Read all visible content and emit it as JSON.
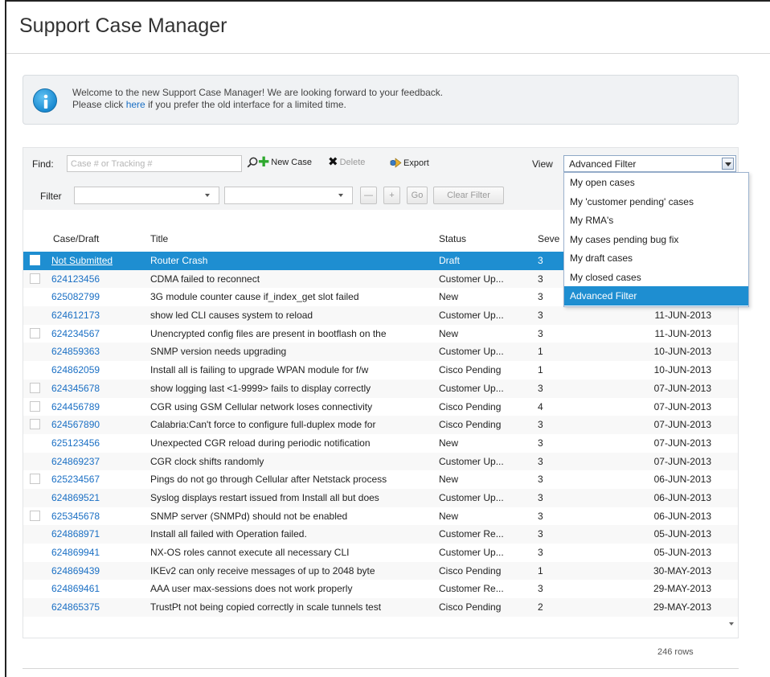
{
  "page": {
    "title": "Support Case Manager"
  },
  "banner": {
    "line1": "Welcome to the new Support Case Manager! We are looking forward to your feedback.",
    "line2_pre": "Please click ",
    "line2_link": "here",
    "line2_post": " if you prefer the old interface for a limited time."
  },
  "toolbar": {
    "find_label": "Find:",
    "find_placeholder": "Case # or Tracking #",
    "new_case": "New Case",
    "delete": "Delete",
    "export": "Export",
    "view_label": "View",
    "view_value": "Advanced Filter",
    "filter_label": "Filter",
    "go": "Go",
    "clear_filter": "Clear Filter",
    "minus_symbol": "—",
    "plus_symbol": "+"
  },
  "view_options": [
    "My open cases",
    "My 'customer pending' cases",
    "My RMA's",
    "My cases pending bug fix",
    "My draft cases",
    "My closed cases",
    "Advanced Filter"
  ],
  "columns": {
    "case": "Case/Draft",
    "title": "Title",
    "status": "Status",
    "severity": "Seve"
  },
  "rows": [
    {
      "case": "Not Submitted",
      "title": "Router Crash",
      "status": "Draft",
      "sev": "3",
      "date": "",
      "checkbox": true,
      "selected": true
    },
    {
      "case": "624123456",
      "title": "CDMA failed to reconnect",
      "status": "Customer Up...",
      "sev": "3",
      "date": "",
      "checkbox": true
    },
    {
      "case": "625082799",
      "title": "3G module counter cause if_index_get  slot failed",
      "status": "New",
      "sev": "3",
      "date": "",
      "checkbox": false
    },
    {
      "case": "624612173",
      "title": "show led CLI causes system to reload",
      "status": "Customer Up...",
      "sev": "3",
      "date": "11-JUN-2013",
      "checkbox": false
    },
    {
      "case": "624234567",
      "title": "Unencrypted config files are present in bootflash on the",
      "status": "New",
      "sev": "3",
      "date": "11-JUN-2013",
      "checkbox": true
    },
    {
      "case": "624859363",
      "title": "SNMP version needs upgrading",
      "status": "Customer Up...",
      "sev": "1",
      "date": "10-JUN-2013",
      "checkbox": false
    },
    {
      "case": "624862059",
      "title": "Install all is failing to upgrade WPAN module for f/w",
      "status": "Cisco Pending",
      "sev": "1",
      "date": "10-JUN-2013",
      "checkbox": false
    },
    {
      "case": "624345678",
      "title": "show logging last <1-9999> fails to display correctly",
      "status": "Customer Up...",
      "sev": "3",
      "date": "07-JUN-2013",
      "checkbox": true
    },
    {
      "case": "624456789",
      "title": "CGR using GSM Cellular network loses connectivity",
      "status": "Cisco Pending",
      "sev": "4",
      "date": "07-JUN-2013",
      "checkbox": true
    },
    {
      "case": "624567890",
      "title": "Calabria:Can't force to configure full-duplex mode for",
      "status": "Cisco Pending",
      "sev": "3",
      "date": "07-JUN-2013",
      "checkbox": true
    },
    {
      "case": "625123456",
      "title": "Unexpected CGR reload during periodic notification",
      "status": "New",
      "sev": "3",
      "date": "07-JUN-2013",
      "checkbox": false
    },
    {
      "case": "624869237",
      "title": "CGR clock shifts randomly",
      "status": "Customer Up...",
      "sev": "3",
      "date": "07-JUN-2013",
      "checkbox": false
    },
    {
      "case": "625234567",
      "title": "Pings do not go through Cellular after Netstack process",
      "status": "New",
      "sev": "3",
      "date": "06-JUN-2013",
      "checkbox": true
    },
    {
      "case": "624869521",
      "title": "Syslog displays restart issued from Install all but does",
      "status": "Customer Up...",
      "sev": "3",
      "date": "06-JUN-2013",
      "checkbox": false
    },
    {
      "case": "625345678",
      "title": "SNMP server (SNMPd) should not be enabled",
      "status": "New",
      "sev": "3",
      "date": "06-JUN-2013",
      "checkbox": true
    },
    {
      "case": "624868971",
      "title": "Install all failed with Operation failed.",
      "status": "Customer Re...",
      "sev": "3",
      "date": "05-JUN-2013",
      "checkbox": false
    },
    {
      "case": "624869941",
      "title": "NX-OS roles cannot execute all necessary CLI",
      "status": "Customer Up...",
      "sev": "3",
      "date": "05-JUN-2013",
      "checkbox": false
    },
    {
      "case": "624869439",
      "title": "IKEv2 can only receive messages of up to 2048 byte",
      "status": "Cisco Pending",
      "sev": "1",
      "date": "30-MAY-2013",
      "checkbox": false
    },
    {
      "case": "624869461",
      "title": "AAA user max-sessions does not work properly",
      "status": "Customer Re...",
      "sev": "3",
      "date": "29-MAY-2013",
      "checkbox": false
    },
    {
      "case": "624865375",
      "title": "TrustPt not being copied correctly in scale tunnels test",
      "status": "Cisco Pending",
      "sev": "2",
      "date": "29-MAY-2013",
      "checkbox": false
    }
  ],
  "footer": {
    "rows_count": "246 rows"
  },
  "colors": {
    "accent": "#1e8ed1",
    "link": "#1a6fc4"
  }
}
